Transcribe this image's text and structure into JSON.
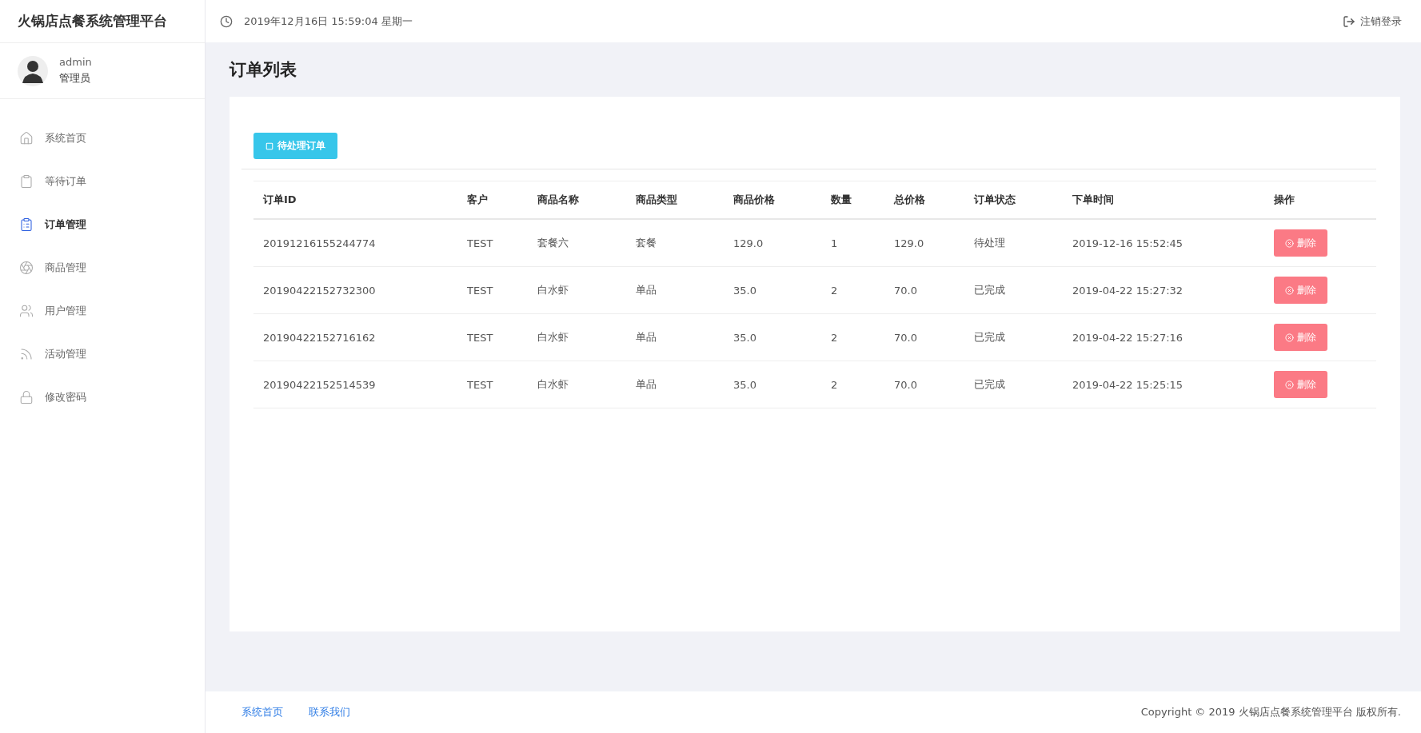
{
  "app_title": "火锅店点餐系统管理平台",
  "header": {
    "datetime": "2019年12月16日 15:59:04 星期一",
    "logout": "注销登录"
  },
  "user": {
    "name": "admin",
    "role": "管理员"
  },
  "sidebar": {
    "items": [
      {
        "label": "系统首页",
        "selected": false
      },
      {
        "label": "等待订单",
        "selected": false
      },
      {
        "label": "订单管理",
        "selected": true
      },
      {
        "label": "商品管理",
        "selected": false
      },
      {
        "label": "用户管理",
        "selected": false
      },
      {
        "label": "活动管理",
        "selected": false
      },
      {
        "label": "修改密码",
        "selected": false
      }
    ]
  },
  "page_title": "订单列表",
  "pending_button": "待处理订单",
  "table": {
    "columns": [
      "订单ID",
      "客户",
      "商品名称",
      "商品类型",
      "商品价格",
      "数量",
      "总价格",
      "订单状态",
      "下单时间",
      "操作"
    ],
    "rows": [
      {
        "cells": [
          "20191216155244774",
          "TEST",
          "套餐六",
          "套餐",
          "129.0",
          "1",
          "129.0",
          "待处理",
          "2019-12-16 15:52:45"
        ],
        "action": "删除"
      },
      {
        "cells": [
          "20190422152732300",
          "TEST",
          "白水虾",
          "单品",
          "35.0",
          "2",
          "70.0",
          "已完成",
          "2019-04-22 15:27:32"
        ],
        "action": "删除"
      },
      {
        "cells": [
          "20190422152716162",
          "TEST",
          "白水虾",
          "单品",
          "35.0",
          "2",
          "70.0",
          "已完成",
          "2019-04-22 15:27:16"
        ],
        "action": "删除"
      },
      {
        "cells": [
          "20190422152514539",
          "TEST",
          "白水虾",
          "单品",
          "35.0",
          "2",
          "70.0",
          "已完成",
          "2019-04-22 15:25:15"
        ],
        "action": "删除"
      }
    ]
  },
  "footer": {
    "links": [
      "系统首页",
      "联系我们"
    ],
    "copyright": "Copyright © 2019 火锅店点餐系统管理平台 版权所有."
  }
}
